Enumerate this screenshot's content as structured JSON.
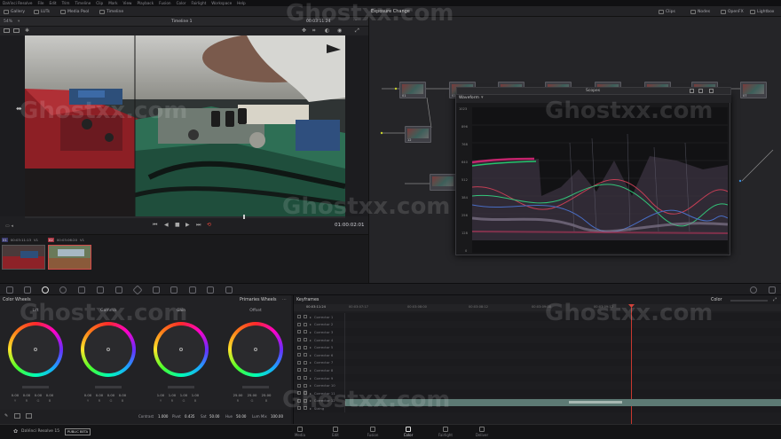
{
  "menu": {
    "items": [
      "DaVinci Resolve",
      "File",
      "Edit",
      "Trim",
      "Timeline",
      "Clip",
      "Mark",
      "View",
      "Playback",
      "Fusion",
      "Color",
      "Fairlight",
      "Workspace",
      "Help"
    ]
  },
  "toolbar": {
    "gallery": "Gallery",
    "luts": "LUTs",
    "media_pool": "Media Pool",
    "timeline": "Timeline",
    "clips": "Clips",
    "nodes": "Nodes",
    "openfx": "OpenFX",
    "lightbox": "Lightbox"
  },
  "viewer": {
    "zoom": "54%",
    "timeline_name": "Timeline 1",
    "timecode": "00:03:11:24",
    "timecode_bottom": "01:00:02:01"
  },
  "node_editor": {
    "title": "Exposure Change",
    "clip_label": "Clip",
    "node_labels": [
      "01",
      "02",
      "12",
      "07"
    ]
  },
  "clips": [
    {
      "index": "01",
      "timecode": "00:03:11:13",
      "track": "V1"
    },
    {
      "index": "02",
      "timecode": "00:03:06:20",
      "track": "V1"
    }
  ],
  "scopes": {
    "title": "Scopes",
    "mode": "Waveform",
    "scale": [
      "1023",
      "896",
      "768",
      "640",
      "512",
      "384",
      "256",
      "128",
      "0"
    ]
  },
  "color_wheels": {
    "title": "Color Wheels",
    "mode": "Primaries Wheels",
    "wheels": [
      {
        "name": "Lift",
        "values": [
          "0.00",
          "0.00",
          "0.00",
          "0.00"
        ]
      },
      {
        "name": "Gamma",
        "values": [
          "0.00",
          "0.00",
          "0.00",
          "0.00"
        ]
      },
      {
        "name": "Gain",
        "values": [
          "1.00",
          "1.00",
          "1.00",
          "1.00"
        ]
      },
      {
        "name": "Offset",
        "values": [
          "25.00",
          "25.00",
          "25.00"
        ]
      }
    ],
    "channel_labels_a": [
      "Y",
      "R",
      "G",
      "B"
    ],
    "channel_labels_b": [
      "R",
      "G",
      "B"
    ],
    "adjust": {
      "contrast_label": "Contrast",
      "contrast": "1.000",
      "pivot_label": "Pivot",
      "pivot": "0.435",
      "sat_label": "Sat",
      "sat": "50.00",
      "hue_label": "Hue",
      "hue": "50.00",
      "lum_mix_label": "Lum Mix",
      "lum_mix": "100.00"
    }
  },
  "keyframes": {
    "title": "Keyframes",
    "mode_label": "Color",
    "timecodes": [
      "00:03:11:24",
      "00:03:07:17",
      "00:03:08:00",
      "00:03:08:12",
      "00:03:09:00",
      "00:03:09:12"
    ],
    "rows": [
      "Corrector 1",
      "Corrector 2",
      "Corrector 3",
      "Corrector 4",
      "Corrector 5",
      "Corrector 6",
      "Corrector 7",
      "Corrector 8",
      "Corrector 9",
      "Corrector 10",
      "Corrector 11",
      "Corrector 12",
      "Sizing"
    ]
  },
  "app": {
    "name": "DaVinci Resolve 15",
    "badge": "PUBLIC BETA"
  },
  "pages": [
    {
      "label": "Media",
      "active": false
    },
    {
      "label": "Edit",
      "active": false
    },
    {
      "label": "Fusion",
      "active": false
    },
    {
      "label": "Color",
      "active": true
    },
    {
      "label": "Fairlight",
      "active": false
    },
    {
      "label": "Deliver",
      "active": false
    }
  ],
  "watermark": "Ghostxx.com",
  "colors": {
    "accent": "#e0463a",
    "panel": "#222225",
    "wheel_ring": "conic"
  }
}
